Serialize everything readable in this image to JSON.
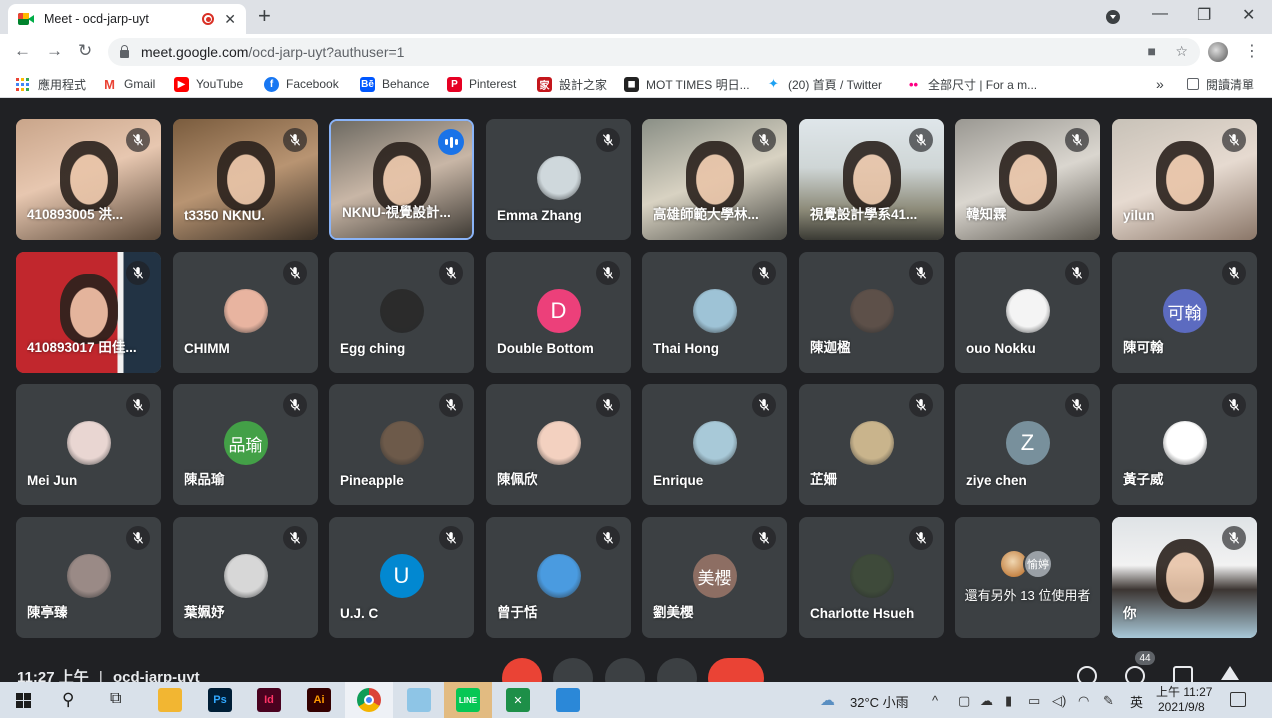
{
  "browser": {
    "tab_title": "Meet - ocd-jarp-uyt",
    "tab_close": "✕",
    "new_tab": "+",
    "url_host": "meet.google.com",
    "url_path": "/ocd-jarp-uyt?authuser=1",
    "minimize": "—",
    "restore": "❐",
    "close": "✕"
  },
  "bookmarks": [
    {
      "label": "應用程式",
      "icon": "apps-grid-icon"
    },
    {
      "label": "Gmail",
      "icon": "gmail-icon",
      "color": "#ea4335"
    },
    {
      "label": "YouTube",
      "icon": "youtube-icon",
      "color": "#ff0000"
    },
    {
      "label": "Facebook",
      "icon": "facebook-icon",
      "color": "#1877f2"
    },
    {
      "label": "Behance",
      "icon": "behance-icon",
      "color": "#0057ff"
    },
    {
      "label": "Pinterest",
      "icon": "pinterest-icon",
      "color": "#e60023"
    },
    {
      "label": "設計之家",
      "icon": "design-home-icon",
      "color": "#c4161c"
    },
    {
      "label": "MOT TIMES 明日...",
      "icon": "mot-times-icon",
      "color": "#222222"
    },
    {
      "label": "(20) 首頁 / Twitter",
      "icon": "twitter-icon",
      "color": "#1da1f2"
    },
    {
      "label": "全部尺寸 | For a m...",
      "icon": "flickr-icon",
      "color": "#ff0084"
    }
  ],
  "bookmarks_overflow": "»",
  "reading_list": "閱讀清單",
  "participants": [
    {
      "name": "410893005 洪...",
      "type": "video"
    },
    {
      "name": "t3350 NKNU.",
      "type": "video"
    },
    {
      "name": "NKNU-視覺設計...",
      "type": "video",
      "speaking": true
    },
    {
      "name": "Emma Zhang",
      "type": "avatar",
      "avatar_color": "#cfd8dc"
    },
    {
      "name": "高雄師範大學林...",
      "type": "video"
    },
    {
      "name": "視覺設計學系41...",
      "type": "video"
    },
    {
      "name": "韓知霖",
      "type": "video"
    },
    {
      "name": "yilun",
      "type": "video"
    },
    {
      "name": "410893017 田佳...",
      "type": "video"
    },
    {
      "name": "CHIMM",
      "type": "avatar",
      "avatar_color": "#e8b4a0"
    },
    {
      "name": "Egg ching",
      "type": "avatar",
      "avatar_color": "#2b2b2b"
    },
    {
      "name": "Double Bottom",
      "type": "initial",
      "initial": "D",
      "avatar_color": "#ec407a"
    },
    {
      "name": "Thai Hong",
      "type": "avatar",
      "avatar_color": "#9ec3d6"
    },
    {
      "name": "陳迦楹",
      "type": "avatar",
      "avatar_color": "#5d5049"
    },
    {
      "name": "ouo Nokku",
      "type": "avatar",
      "avatar_color": "#f4f4f4"
    },
    {
      "name": "陳可翰",
      "type": "initial",
      "initial": "可翰",
      "avatar_color": "#5c6bc0"
    },
    {
      "name": "Mei Jun",
      "type": "avatar",
      "avatar_color": "#e9d6d2"
    },
    {
      "name": "陳品瑜",
      "type": "initial",
      "initial": "品瑜",
      "avatar_color": "#43a047"
    },
    {
      "name": "Pineapple",
      "type": "avatar",
      "avatar_color": "#6d5a4a"
    },
    {
      "name": "陳佩欣",
      "type": "avatar",
      "avatar_color": "#f3d1c0"
    },
    {
      "name": "Enrique",
      "type": "avatar",
      "avatar_color": "#a8c9d8"
    },
    {
      "name": "芷姍",
      "type": "avatar",
      "avatar_color": "#c9b48c"
    },
    {
      "name": "ziye chen",
      "type": "initial",
      "initial": "Z",
      "avatar_color": "#78909c"
    },
    {
      "name": "黃子威",
      "type": "avatar",
      "avatar_color": "#ffffff"
    },
    {
      "name": "陳亭臻",
      "type": "avatar",
      "avatar_color": "#9a8a86"
    },
    {
      "name": "葉姵妤",
      "type": "avatar",
      "avatar_color": "#d7d7d7"
    },
    {
      "name": "U.J. C",
      "type": "initial",
      "initial": "U",
      "avatar_color": "#0288d1"
    },
    {
      "name": "曾于恬",
      "type": "avatar",
      "avatar_color": "#4a9be0"
    },
    {
      "name": "劉美櫻",
      "type": "initial",
      "initial": "美櫻",
      "avatar_color": "#8d6e63"
    },
    {
      "name": "Charlotte Hsueh",
      "type": "avatar",
      "avatar_color": "#3e4a3a"
    },
    {
      "name": "還有另外 13 位使用者",
      "type": "more",
      "stack_initial": "愉婷"
    },
    {
      "name": "你",
      "type": "video",
      "self": true
    }
  ],
  "meeting": {
    "time": "11:27",
    "period": "上午",
    "separator": "|",
    "code": "ocd-jarp-uyt",
    "people_count": "44"
  },
  "taskbar": {
    "weather": "32°C 小雨",
    "ime": "英",
    "clock_time": "上午 11:27",
    "clock_date": "2021/9/8"
  },
  "colors": {
    "meet_bg": "#202124",
    "tile_bg": "#3c4043",
    "speaking_border": "#8ab4f8",
    "end_call_red": "#ea4335"
  }
}
